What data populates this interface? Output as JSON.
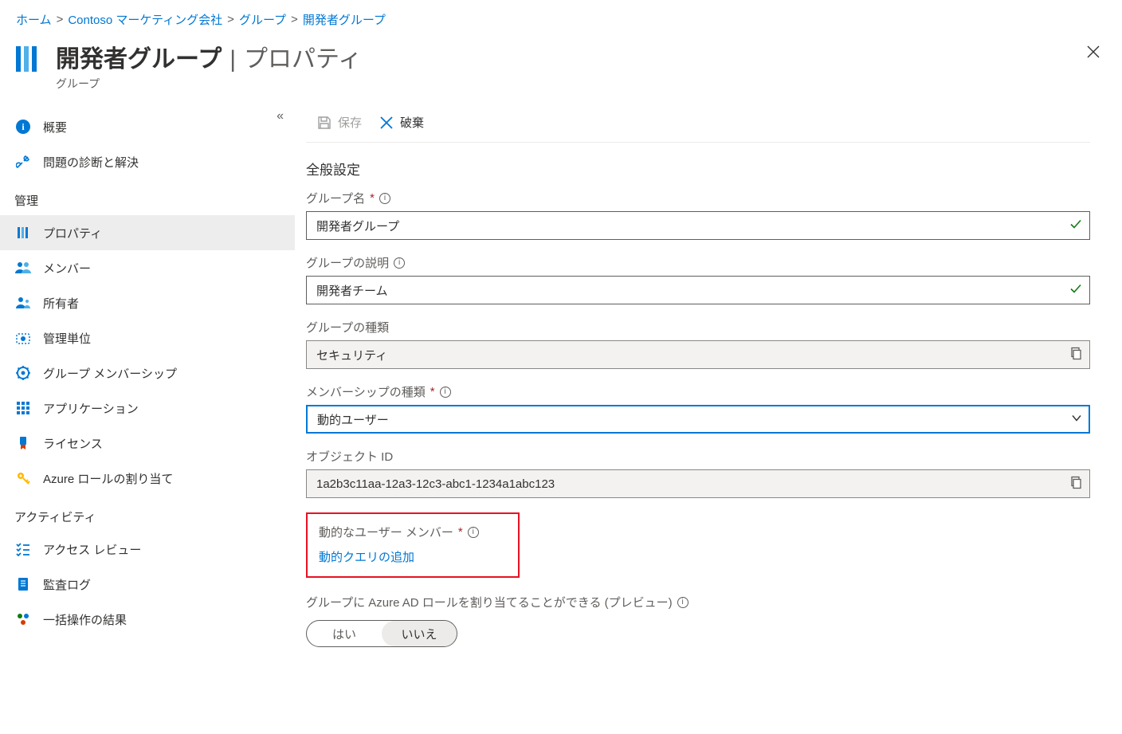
{
  "breadcrumb": {
    "home": "ホーム",
    "org": "Contoso マーケティング会社",
    "groups": "グループ",
    "current": "開発者グループ"
  },
  "header": {
    "title": "開発者グループ",
    "page": "プロパティ",
    "subtitle": "グループ"
  },
  "toolbar": {
    "save": "保存",
    "discard": "破棄"
  },
  "nav": {
    "overview": "概要",
    "diagnose": "問題の診断と解決",
    "section_manage": "管理",
    "properties": "プロパティ",
    "members": "メンバー",
    "owners": "所有者",
    "admin_units": "管理単位",
    "group_membership": "グループ メンバーシップ",
    "applications": "アプリケーション",
    "licenses": "ライセンス",
    "azure_roles": "Azure ロールの割り当て",
    "section_activity": "アクティビティ",
    "access_reviews": "アクセス レビュー",
    "audit_logs": "監査ログ",
    "bulk_results": "一括操作の結果"
  },
  "form": {
    "section_general": "全般設定",
    "group_name_label": "グループ名",
    "group_name_value": "開発者グループ",
    "group_desc_label": "グループの説明",
    "group_desc_value": "開発者チーム",
    "group_type_label": "グループの種類",
    "group_type_value": "セキュリティ",
    "membership_type_label": "メンバーシップの種類",
    "membership_type_value": "動的ユーザー",
    "object_id_label": "オブジェクト ID",
    "object_id_value": "1a2b3c11aa-12a3-12c3-abc1-1234a1abc123",
    "dynamic_members_label": "動的なユーザー メンバー",
    "add_dynamic_query": "動的クエリの追加",
    "aad_roles_label": "グループに Azure AD ロールを割り当てることができる (プレビュー)",
    "yes": "はい",
    "no": "いいえ"
  }
}
